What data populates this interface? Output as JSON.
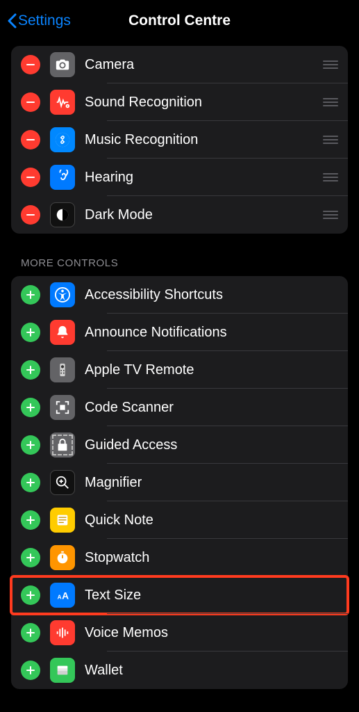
{
  "nav": {
    "back_label": "Settings",
    "title": "Control Centre"
  },
  "sections": {
    "more_header": "MORE CONTROLS"
  },
  "included": [
    {
      "id": "camera",
      "label": "Camera"
    },
    {
      "id": "sound-recognition",
      "label": "Sound Recognition"
    },
    {
      "id": "music-recognition",
      "label": "Music Recognition"
    },
    {
      "id": "hearing",
      "label": "Hearing"
    },
    {
      "id": "dark-mode",
      "label": "Dark Mode"
    }
  ],
  "more": [
    {
      "id": "accessibility-shortcuts",
      "label": "Accessibility Shortcuts"
    },
    {
      "id": "announce-notifications",
      "label": "Announce Notifications"
    },
    {
      "id": "apple-tv-remote",
      "label": "Apple TV Remote"
    },
    {
      "id": "code-scanner",
      "label": "Code Scanner"
    },
    {
      "id": "guided-access",
      "label": "Guided Access"
    },
    {
      "id": "magnifier",
      "label": "Magnifier"
    },
    {
      "id": "quick-note",
      "label": "Quick Note"
    },
    {
      "id": "stopwatch",
      "label": "Stopwatch"
    },
    {
      "id": "text-size",
      "label": "Text Size",
      "highlight": true
    },
    {
      "id": "voice-memos",
      "label": "Voice Memos"
    },
    {
      "id": "wallet",
      "label": "Wallet"
    }
  ]
}
